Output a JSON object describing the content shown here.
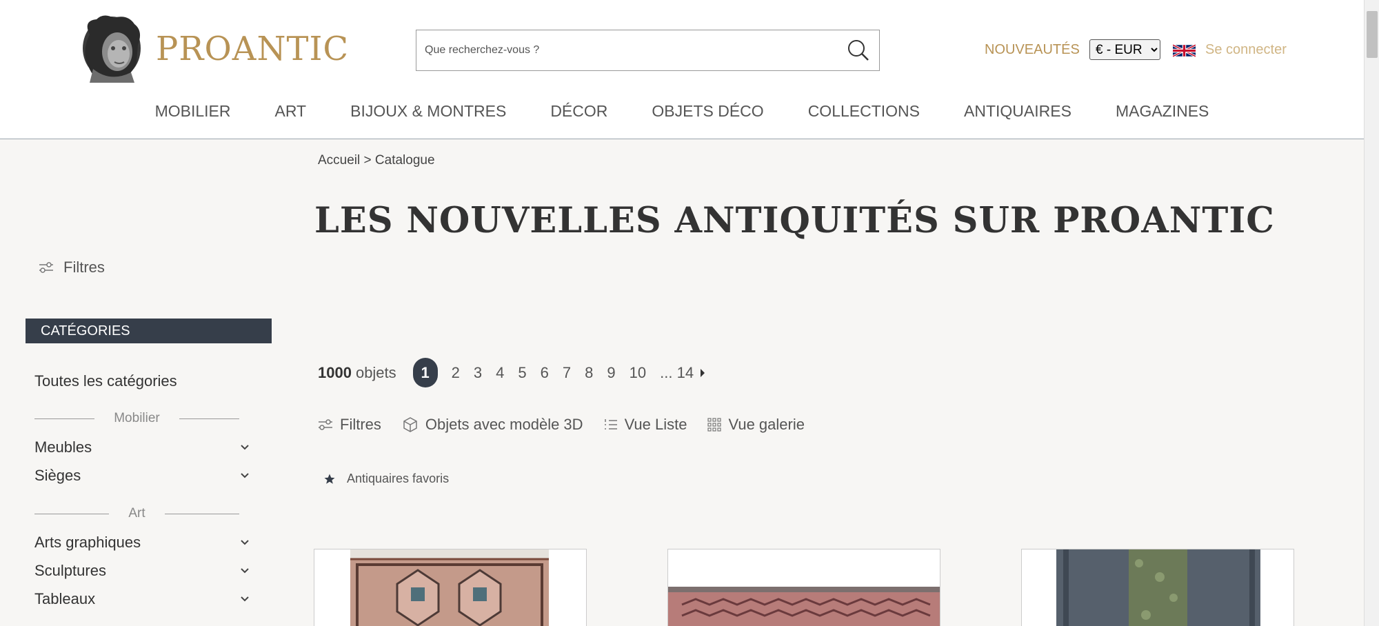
{
  "header": {
    "logo_text": "PROANTIC",
    "search_placeholder": "Que recherchez-vous ?",
    "new_label": "NOUVEAUTÉS",
    "currency": {
      "selected": "€ - EUR",
      "options": [
        "€ - EUR"
      ]
    },
    "language_flag": "uk-flag-icon",
    "login_label": "Se connecter",
    "colors": {
      "brand_gold": "#b89355",
      "login_gold": "#d0b584",
      "dark_slate": "#363e4a"
    }
  },
  "nav": {
    "items": [
      "MOBILIER",
      "ART",
      "BIJOUX & MONTRES",
      "DÉCOR",
      "OBJETS DÉCO",
      "COLLECTIONS",
      "ANTIQUAIRES",
      "MAGAZINES"
    ]
  },
  "breadcrumb": {
    "home": "Accueil",
    "separator": ">",
    "current": "Catalogue"
  },
  "page_title": "LES NOUVELLES ANTIQUITÉS SUR PROANTIC",
  "sidebar": {
    "filters_label": "Filtres",
    "categories_header": "CATÉGORIES",
    "all_categories": "Toutes les catégories",
    "groups": [
      {
        "label": "Mobilier",
        "items": [
          "Meubles",
          "Sièges"
        ]
      },
      {
        "label": "Art",
        "items": [
          "Arts graphiques",
          "Sculptures",
          "Tableaux"
        ]
      }
    ]
  },
  "results": {
    "count": "1000",
    "count_unit": "objets",
    "pages": [
      "1",
      "2",
      "3",
      "4",
      "5",
      "6",
      "7",
      "8",
      "9",
      "10"
    ],
    "active_page": "1",
    "last_page_label": "... 14"
  },
  "toolbar": {
    "filters": "Filtres",
    "objects_3d": "Objets avec modèle 3D",
    "list_view": "Vue Liste",
    "gallery_view": "Vue galerie"
  },
  "favorites_label": "Antiquaires favoris",
  "products": [
    {
      "image": "persian-rug-photo"
    },
    {
      "image": "red-kilim-rug-photo"
    },
    {
      "image": "green-runner-rug-photo"
    }
  ]
}
